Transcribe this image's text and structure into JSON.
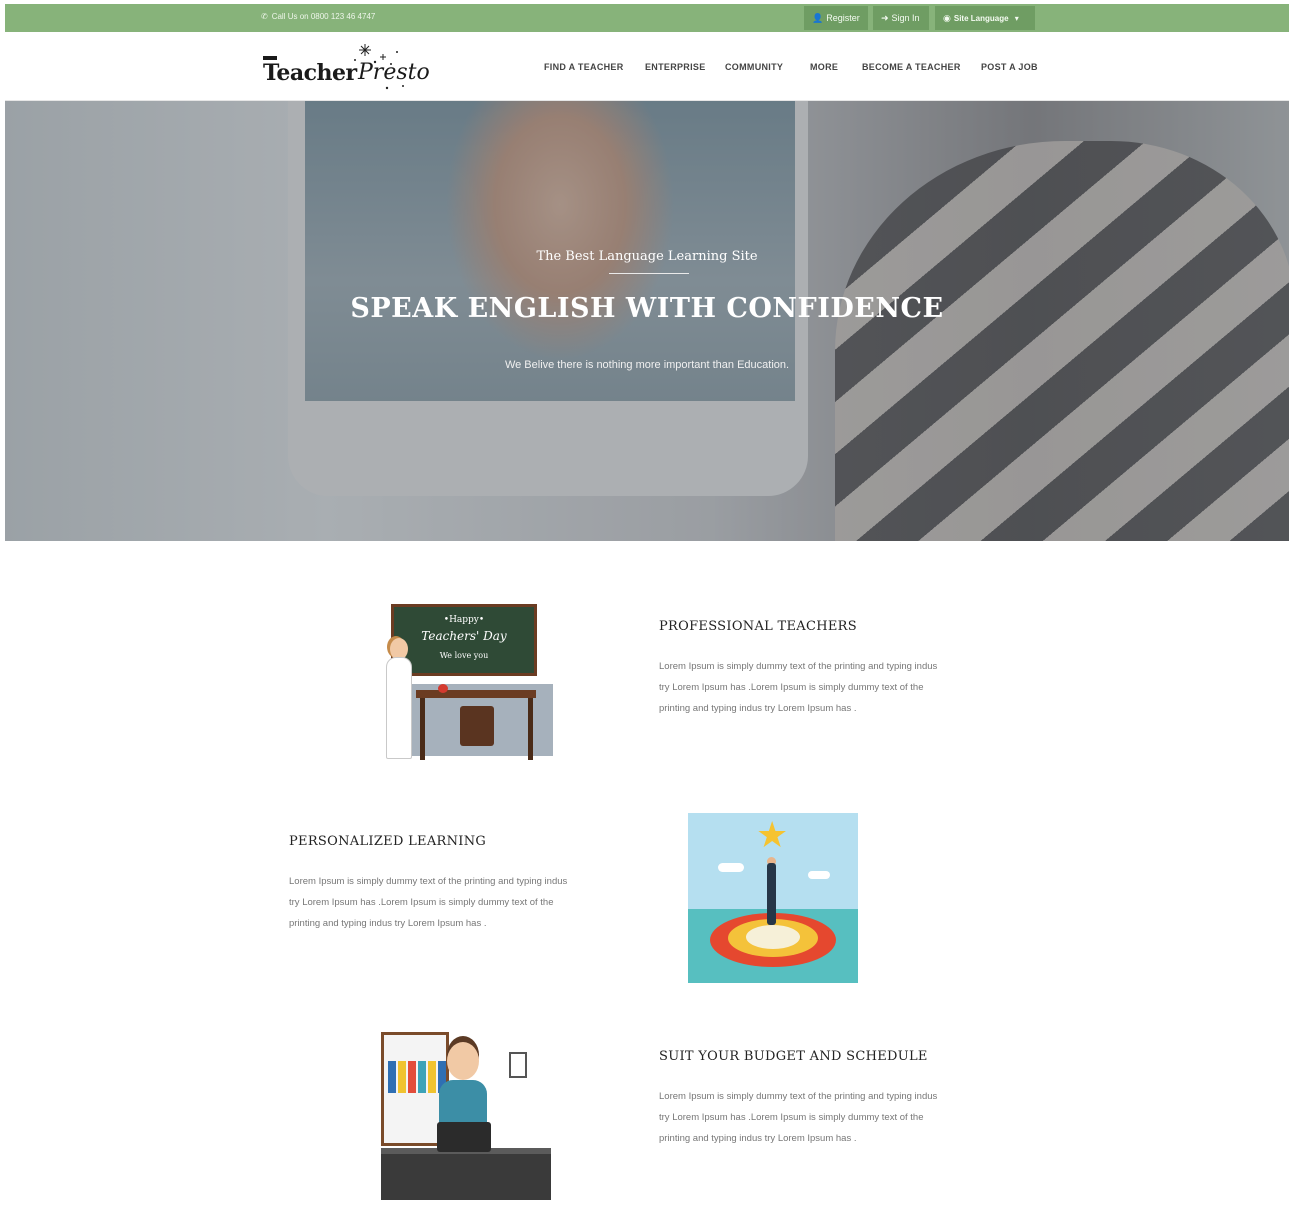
{
  "topbar": {
    "call_text": "Call Us on 0800 123 46 4747",
    "register_label": "Register",
    "signin_label": "Sign In",
    "language_label": "Site Language",
    "language_caret": "▾"
  },
  "logo": {
    "part1": "Teacher",
    "part2": "Presto"
  },
  "nav": {
    "items": [
      "FIND A TEACHER",
      "ENTERPRISE",
      "COMMUNITY",
      "MORE",
      "BECOME A TEACHER",
      "POST A JOB"
    ]
  },
  "hero": {
    "tagline": "The Best Language Learning Site",
    "title": "SPEAK ENGLISH WITH CONFIDENCE",
    "subtitle": "We Belive there is nothing more important than Education."
  },
  "features": [
    {
      "title": "PROFESSIONAL TEACHERS",
      "body": "Lorem Ipsum is simply dummy text of the printing and typing indus try Lorem Ipsum has .Lorem Ipsum is simply dummy text of the printing and typing indus try Lorem Ipsum has ."
    },
    {
      "title": "PERSONALIZED LEARNING",
      "body": "Lorem Ipsum is simply dummy text of the printing and typing indus try Lorem Ipsum has .Lorem Ipsum is simply dummy text of the printing and typing indus try Lorem Ipsum has ."
    },
    {
      "title": "SUIT YOUR BUDGET AND SCHEDULE",
      "body": "Lorem Ipsum is simply dummy text of the printing and typing indus try Lorem Ipsum has .Lorem Ipsum is simply dummy text of the printing and typing indus try Lorem Ipsum has ."
    }
  ],
  "illustrations": {
    "chalkboard": {
      "line1": "•Happy•",
      "line2": "Teachers' Day",
      "line3": "We love you"
    }
  },
  "icons": {
    "phone": "phone-icon",
    "user": "user-icon",
    "signin": "sign-in-icon",
    "globe": "globe-icon"
  },
  "colors": {
    "topbar": "#87b37a",
    "topbar_button": "#6f9d63",
    "hero_overlay": "#46484e"
  }
}
